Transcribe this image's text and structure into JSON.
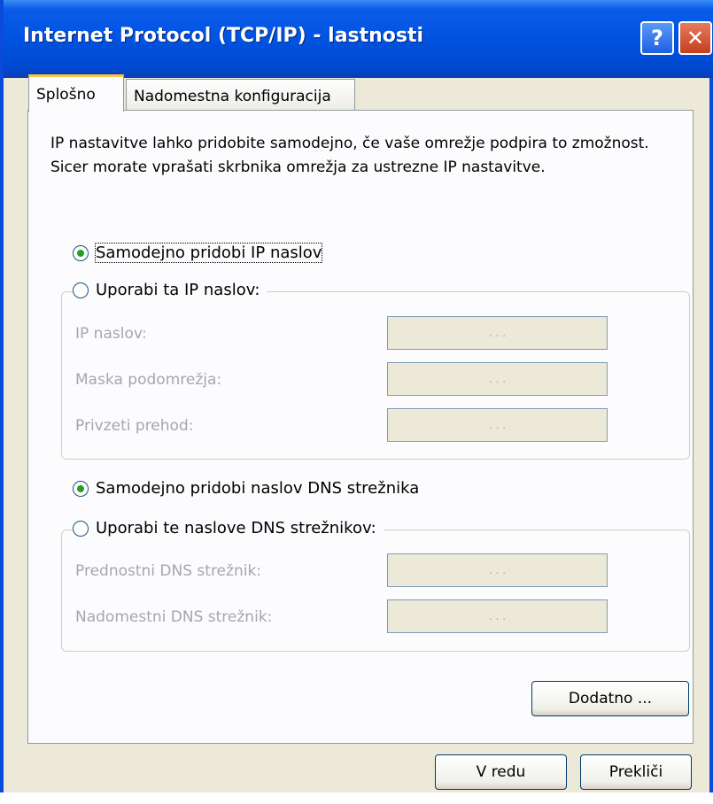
{
  "window": {
    "title": "Internet Protocol (TCP/IP) - lastnosti",
    "help_label": "?",
    "close_label": "✕"
  },
  "tabs": [
    {
      "label": "Splošno",
      "active": true
    },
    {
      "label": "Nadomestna konfiguracija",
      "active": false
    }
  ],
  "description": "IP nastavitve lahko pridobite samodejno, če vaše omrežje podpira to zmožnost. Sicer morate vprašati skrbnika omrežja za ustrezne IP nastavitve.",
  "ip_section": {
    "auto_option": {
      "label": "Samodejno pridobi IP naslov",
      "checked": true
    },
    "manual_option": {
      "label": "Uporabi ta IP naslov:",
      "checked": false
    },
    "fields": [
      {
        "label": "IP naslov:",
        "value": ".   .   ."
      },
      {
        "label": "Maska podomrežja:",
        "value": ".   .   ."
      },
      {
        "label": "Privzeti prehod:",
        "value": ".   .   ."
      }
    ]
  },
  "dns_section": {
    "auto_option": {
      "label": "Samodejno pridobi naslov DNS strežnika",
      "checked": true
    },
    "manual_option": {
      "label": "Uporabi te naslove DNS strežnikov:",
      "checked": false
    },
    "fields": [
      {
        "label": "Prednostni DNS strežnik:",
        "value": ".   .   ."
      },
      {
        "label": "Nadomestni DNS strežnik:",
        "value": ".   .   ."
      }
    ]
  },
  "buttons": {
    "advanced": "Dodatno ...",
    "ok": "V redu",
    "cancel": "Prekliči"
  },
  "colors": {
    "titlebar": "#0053E1",
    "dialog_bg": "#ECE9D8",
    "radio_dot": "#21A121",
    "disabled_text": "#A7A6AA"
  }
}
